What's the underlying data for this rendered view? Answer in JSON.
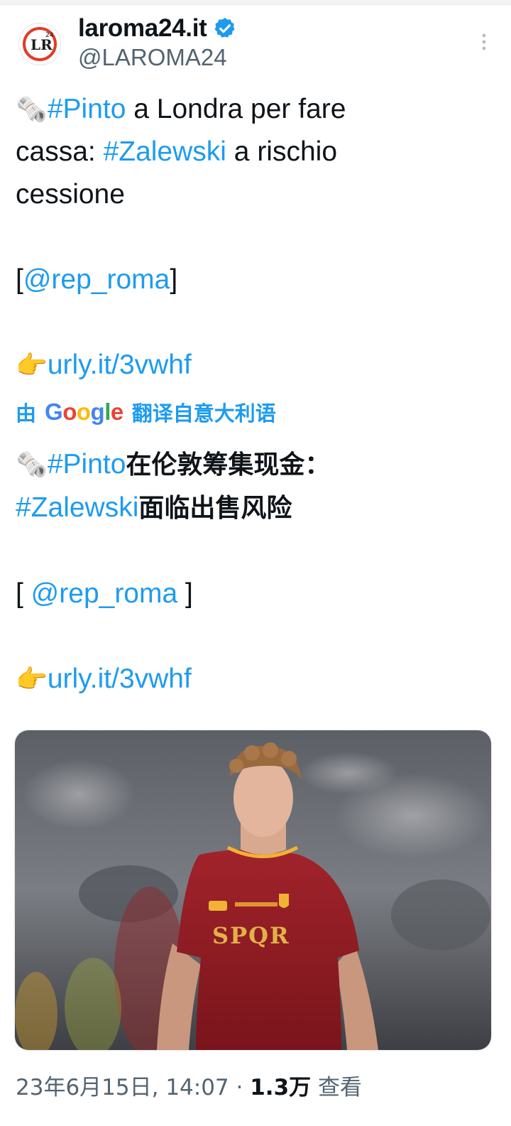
{
  "account": {
    "display_name": "laroma24.it",
    "handle": "@LAROMA24",
    "avatar_label": "LR",
    "avatar_badge": "24",
    "verified_icon": "verified-badge-icon",
    "more_icon": "more-vertical-icon"
  },
  "tweet": {
    "line1_emoji": "🗞️",
    "line1_tag": "#Pinto",
    "line1_rest": " a Londra per fare",
    "line2_start": "cassa: ",
    "line2_tag": "#Zalewski",
    "line2_rest": " a rischio",
    "line3": "cessione",
    "source_open": "[",
    "source_mention": "@rep_roma",
    "source_close": "]",
    "link_emoji": "👉",
    "link_text": "urly.it/3vwhf"
  },
  "translation": {
    "prefix": "由",
    "provider": "Google",
    "action": "翻译自意大利语",
    "line1_emoji": "🗞️",
    "line1_tag": "#Pinto",
    "line1_rest": "在伦敦筹集现金：",
    "line2_tag": "#Zalewski",
    "line2_rest": "面临出售风险",
    "source_open": "[ ",
    "source_mention": "@rep_roma",
    "source_close": " ]",
    "link_emoji": "👉",
    "link_text": "urly.it/3vwhf"
  },
  "media": {
    "jersey_text": "SPQR"
  },
  "meta": {
    "timestamp": "23年6月15日, 14:07 · ",
    "views_count": "1.3万",
    "views_label": " 查看"
  },
  "colors": {
    "link": "#1d9bf0",
    "text": "#0f1419",
    "muted": "#536471",
    "jersey": "#8e1b22",
    "jersey_trim": "#f2b233"
  }
}
